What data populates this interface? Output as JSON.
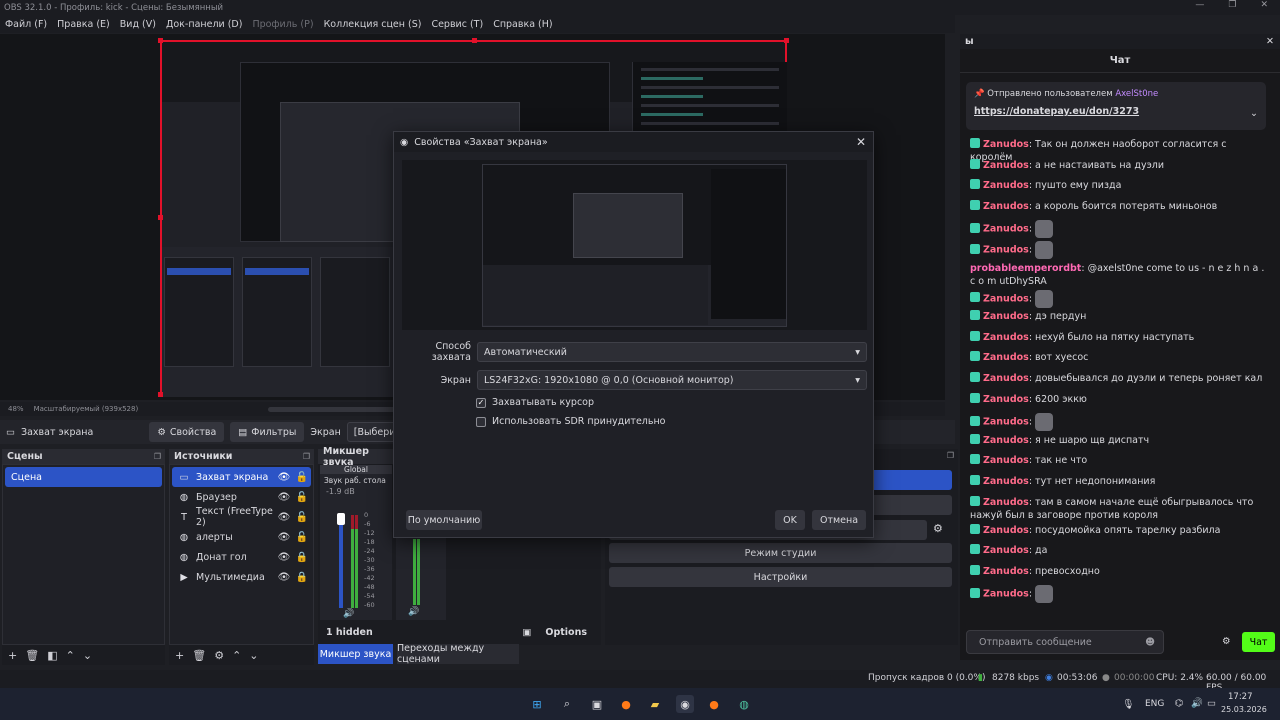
{
  "window": {
    "title": "OBS 32.1.0 - Профиль: kick - Сцены: Безымянный",
    "controls": [
      "—",
      "❐",
      "✕"
    ]
  },
  "menu": [
    "Файл (F)",
    "Правка (E)",
    "Вид (V)",
    "Док-панели (D)",
    "Профиль (P)",
    "Коллекция сцен (S)",
    "Сервис (T)",
    "Справка (H)"
  ],
  "preview": {
    "zoom": "48%",
    "scale_label": "Масштабируемый (939x528)"
  },
  "source_toolbar": {
    "source_name": "Захват экрана",
    "properties": "Свойства",
    "filters": "Фильтры",
    "screen_label": "Экран",
    "screen_value": "[Выберите экра"
  },
  "scenes": {
    "title": "Сцены",
    "items": [
      "Сцена"
    ]
  },
  "sources": {
    "title": "Источники",
    "items": [
      {
        "icon": "monitor-icon",
        "glyph": "▭",
        "name": "Захват экрана",
        "locked": false
      },
      {
        "icon": "globe-icon",
        "glyph": "◍",
        "name": "Браузер",
        "locked": false
      },
      {
        "icon": "text-icon",
        "glyph": "T",
        "name": "Текст (FreeType 2)",
        "locked": false
      },
      {
        "icon": "globe-icon",
        "glyph": "◍",
        "name": "алерты",
        "locked": false
      },
      {
        "icon": "globe-icon",
        "glyph": "◍",
        "name": "Донат гол",
        "locked": true
      },
      {
        "icon": "play-icon",
        "glyph": "▶",
        "name": "Мультимедиа",
        "locked": true
      }
    ]
  },
  "mixer": {
    "title": "Микшер звука",
    "global": "Global",
    "channel": "Звук раб. стола",
    "level": "-1.9 dB",
    "ticks": [
      "0",
      "-6",
      "-12",
      "-18",
      "-24",
      "-30",
      "-36",
      "-42",
      "-48",
      "-54",
      "-60"
    ],
    "hidden": "1 hidden",
    "options": "Options"
  },
  "bottom_tabs": [
    "Микшер звука",
    "Переходы между сценами"
  ],
  "controls": {
    "studio": "Режим студии",
    "settings": "Настройки"
  },
  "dialog": {
    "title": "Свойства «Захват экрана»",
    "method_label": "Способ захвата",
    "method_value": "Автоматический",
    "screen_label": "Экран",
    "screen_value": "LS24F32xG: 1920x1080 @ 0,0 (Основной монитор)",
    "capture_cursor": "Захватывать курсор",
    "force_sdr": "Использовать SDR принудительно",
    "defaults": "По умолчанию",
    "ok": "OK",
    "cancel": "Отмена"
  },
  "chat": {
    "dock_title": "ы",
    "title": "Чат",
    "pinned_by": "Отправлено пользователем",
    "pinned_user": "AxelSt0ne",
    "pinned_link": "https://donatepay.eu/don/3273",
    "messages": [
      {
        "user": "Zanudos",
        "text": "Так он должен наоборот согласится с королём"
      },
      {
        "user": "Zanudos",
        "text": "а не настаивать на дуэли"
      },
      {
        "user": "Zanudos",
        "text": "пушто ему пизда"
      },
      {
        "user": "Zanudos",
        "text": "а король боится потерять миньонов"
      },
      {
        "user": "Zanudos",
        "text": "",
        "emote": true
      },
      {
        "user": "Zanudos",
        "text": "",
        "emote": true
      },
      {
        "user": "probableemperordbt",
        "text": "@axelst0ne come to us - n e z h n a . c o m utDhySRA",
        "nobadge": true
      },
      {
        "user": "Zanudos",
        "text": "",
        "emote": true
      },
      {
        "user": "Zanudos",
        "text": "дэ пердун"
      },
      {
        "user": "Zanudos",
        "text": "нехуй было на пятку наступать"
      },
      {
        "user": "Zanudos",
        "text": "вот хуесос"
      },
      {
        "user": "Zanudos",
        "text": "довыебывался до дуэли и теперь роняет кал"
      },
      {
        "user": "Zanudos",
        "text": "6200 эккю"
      },
      {
        "user": "Zanudos",
        "text": "",
        "emote": true
      },
      {
        "user": "Zanudos",
        "text": "я не шарю щв диспатч"
      },
      {
        "user": "Zanudos",
        "text": "так не что"
      },
      {
        "user": "Zanudos",
        "text": "тут нет недопонимания"
      },
      {
        "user": "Zanudos",
        "text": "там в самом начале ещё обыгрывалось что нажуй был в заговоре против короля"
      },
      {
        "user": "Zanudos",
        "text": "посудомойка опять тарелку разбила"
      },
      {
        "user": "Zanudos",
        "text": "да"
      },
      {
        "user": "Zanudos",
        "text": "превосходно"
      },
      {
        "user": "Zanudos",
        "text": "",
        "emote": true
      }
    ],
    "input_placeholder": "Отправить сообщение",
    "send": "Чат"
  },
  "status": {
    "dropped": "Пропуск кадров 0 (0.0%)",
    "bitrate": "8278 kbps",
    "rec_time": "00:53:06",
    "stream_time": "00:00:00",
    "cpu": "CPU: 2.4%",
    "fps": "60.00 / 60.00 FPS"
  },
  "tray": {
    "lang": "ENG",
    "time": "17:27",
    "date": "25.03.2026"
  },
  "colors": {
    "accent": "#2c54c6",
    "kick_green": "#53fc18",
    "selection_red": "#e2112a",
    "username": "#ff6b8a"
  }
}
